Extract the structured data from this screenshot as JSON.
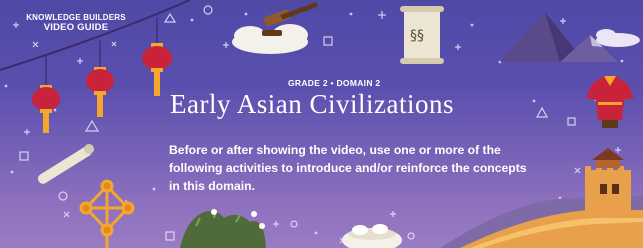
{
  "brand": {
    "line1": "KNOWLEDGE BUILDERS",
    "line2": "VIDEO GUIDE"
  },
  "header": {
    "subtitle": "GRADE 2 • DOMAIN 2",
    "title": "Early Asian Civilizations"
  },
  "intro": {
    "text": "Before or after showing the video, use one or more of the following activities to introduce and/or reinforce the concepts in this domain."
  },
  "colors": {
    "background_top": "#4f49a6",
    "background_bottom": "#9a7cc4",
    "lantern_red": "#c8233a",
    "lantern_tassel": "#f5a72c",
    "text": "#ffffff"
  },
  "icons": [
    "string-of-lanterns-icon",
    "gavel-on-cloud-icon",
    "scroll-icon",
    "mountains-icon",
    "robe-icon",
    "abacus-icon",
    "rolled-scroll-icon",
    "great-wall-icon",
    "bowl-icon",
    "shrub-icon"
  ]
}
